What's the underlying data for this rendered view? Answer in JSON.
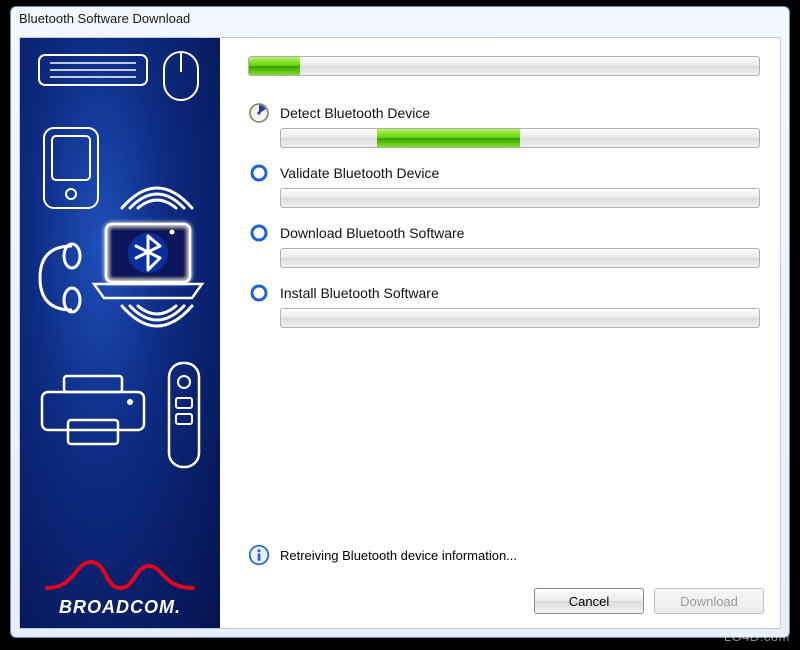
{
  "window": {
    "title": "Bluetooth Software Download"
  },
  "brand": {
    "name": "BROADCOM."
  },
  "progress": {
    "overall_percent": 10,
    "overall_mode": "determinate"
  },
  "steps": [
    {
      "label": "Detect Bluetooth Device",
      "state": "active",
      "progress_percent": 40,
      "progress_mode": "marquee"
    },
    {
      "label": "Validate Bluetooth Device",
      "state": "pending",
      "progress_percent": 0,
      "progress_mode": "empty"
    },
    {
      "label": "Download Bluetooth Software",
      "state": "pending",
      "progress_percent": 0,
      "progress_mode": "empty"
    },
    {
      "label": "Install Bluetooth Software",
      "state": "pending",
      "progress_percent": 0,
      "progress_mode": "empty"
    }
  ],
  "status": {
    "message": "Retreiving Bluetooth device information..."
  },
  "buttons": {
    "cancel": {
      "label": "Cancel",
      "enabled": true
    },
    "download": {
      "label": "Download",
      "enabled": false
    }
  },
  "watermark": "LO4D.com",
  "colors": {
    "accent_green": "#5fcf1a",
    "brand_red": "#e1061a",
    "sidebar_blue": "#0d2b82"
  }
}
